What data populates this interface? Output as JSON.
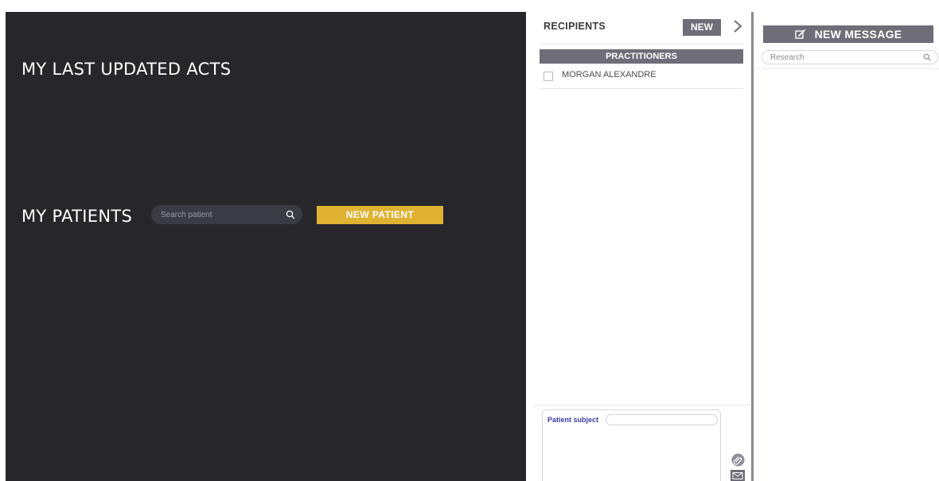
{
  "dashboard": {
    "acts_title": "MY LAST UPDATED ACTS",
    "patients_title": "MY PATIENTS",
    "patient_search_placeholder": "Search patient",
    "new_patient_label": "NEW PATIENT"
  },
  "recipients": {
    "title": "RECIPIENTS",
    "new_label": "NEW",
    "group_label": "PRACTITIONERS",
    "items": [
      {
        "name": "MORGAN ALEXANDRE",
        "checked": false
      }
    ]
  },
  "compose": {
    "subject_label": "Patient subject",
    "subject_value": ""
  },
  "messages": {
    "new_message_label": "NEW MESSAGE",
    "search_placeholder": "Research"
  },
  "colors": {
    "dark_panel": "#26262b",
    "accent_yellow": "#e0b232",
    "header_gray": "#6e6d78"
  },
  "icons": {
    "patient_search": "search-icon",
    "expand": "chevron-right-icon",
    "attach": "paperclip-icon",
    "send": "envelope-icon",
    "new_message": "edit-icon",
    "message_search": "search-icon"
  }
}
